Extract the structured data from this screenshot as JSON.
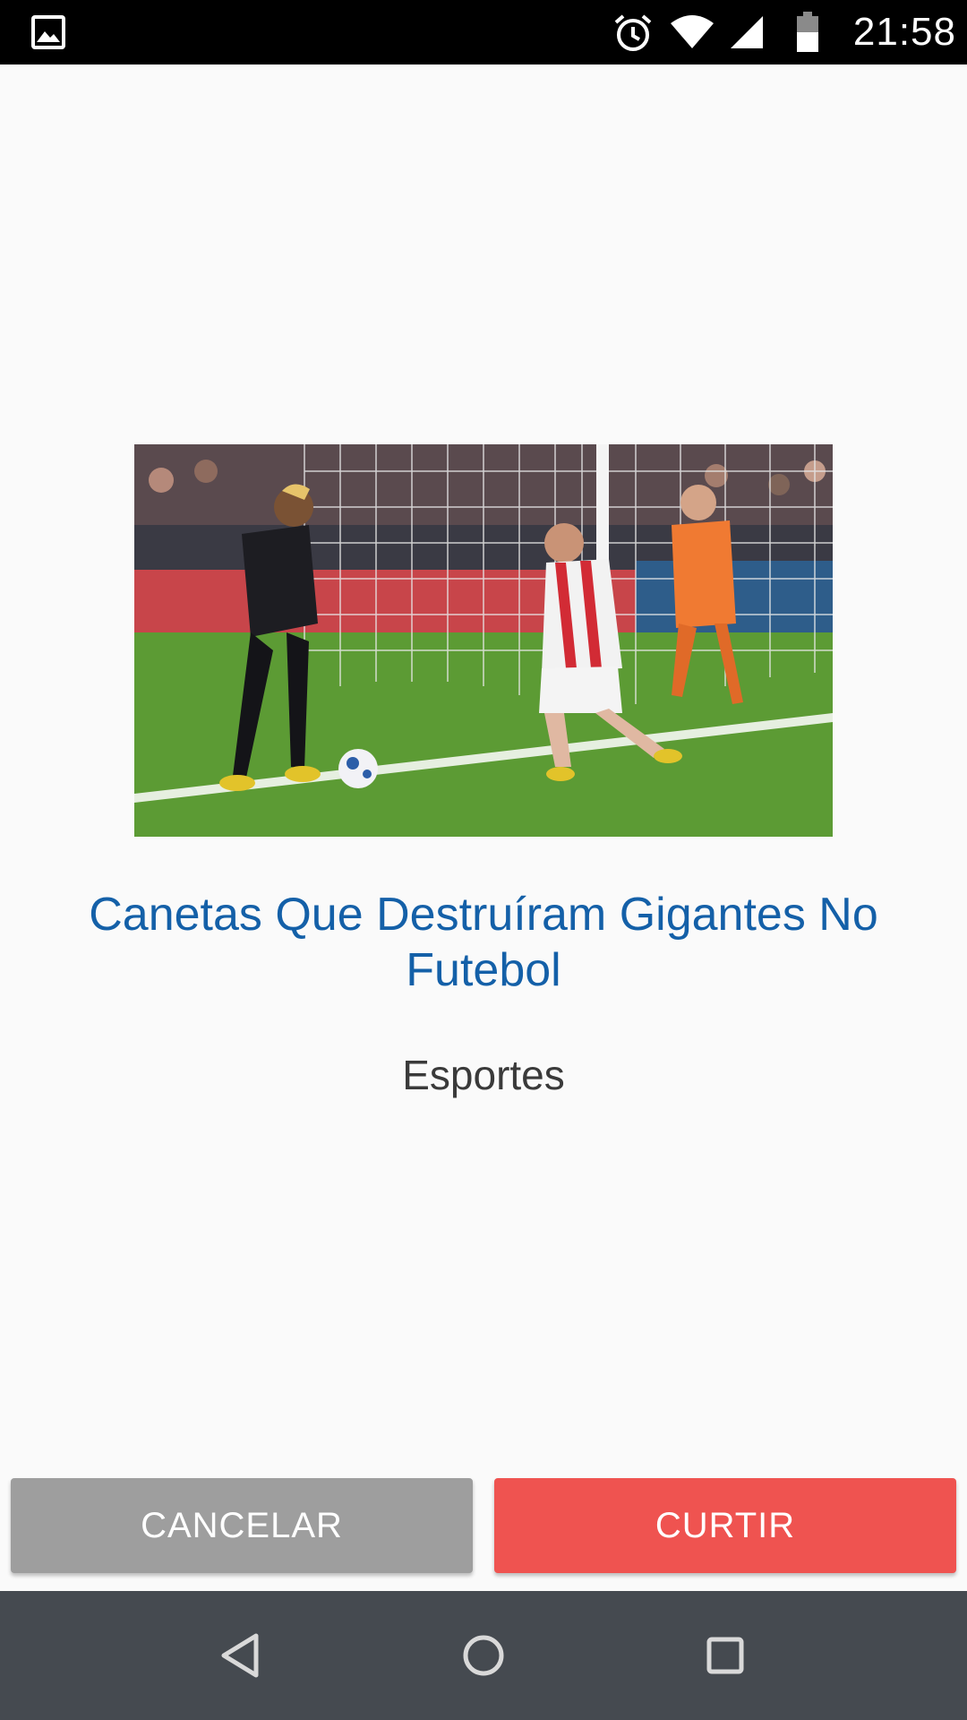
{
  "status_bar": {
    "time": "21:58",
    "icons": [
      "gallery-icon",
      "alarm-icon",
      "wifi-icon",
      "signal-icon",
      "battery-icon"
    ]
  },
  "content": {
    "image_subject": "football-players-photo",
    "title": "Canetas Que Destruíram Gigantes No Futebol",
    "category": "Esportes"
  },
  "actions": {
    "cancel_label": "CANCELAR",
    "like_label": "CURTIR"
  },
  "navigation": {
    "icons": [
      "back-icon",
      "home-icon",
      "recents-icon"
    ]
  },
  "colors": {
    "title": "#1460a8",
    "cancel_button": "#9e9e9e",
    "like_button": "#ef5350",
    "nav_bar": "#454a50",
    "status_bar": "#000000",
    "background": "#fafafa"
  }
}
